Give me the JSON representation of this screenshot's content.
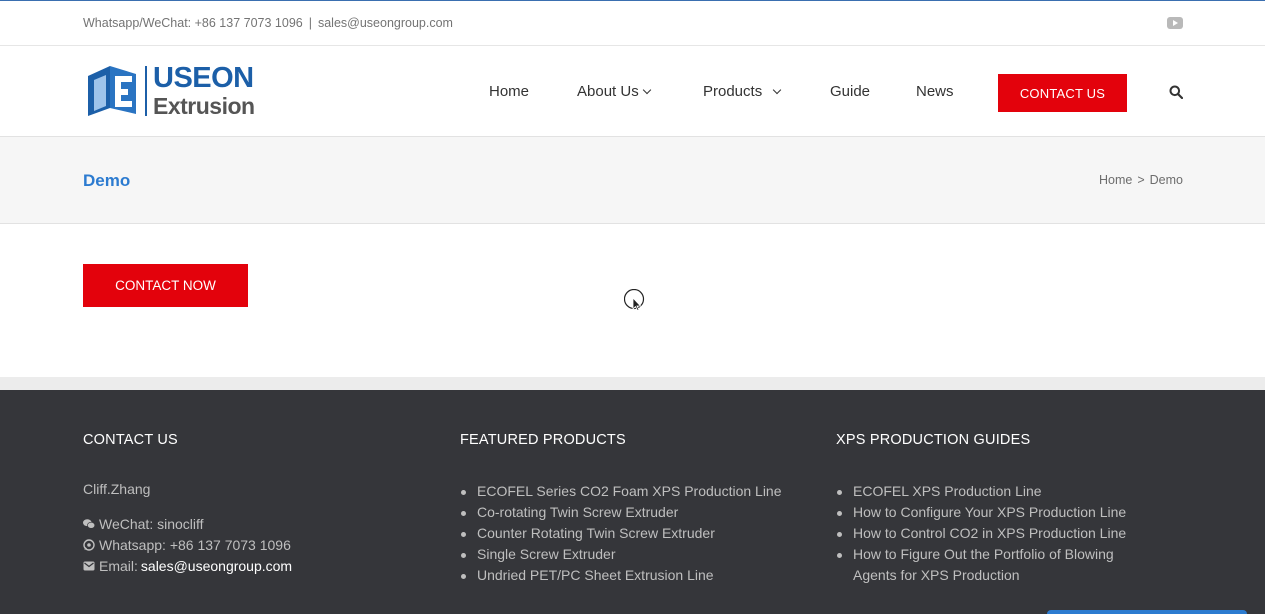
{
  "topbar": {
    "whatsapp": "Whatsapp/WeChat: +86 137 7073 1096",
    "separator": "|",
    "email": "sales@useongroup.com",
    "social_icon": "youtube-icon"
  },
  "brand": {
    "name_line1": "USEON",
    "name_line2": "Extrusion",
    "primary_color": "#1c5fa8",
    "accent_color": "#e3020c"
  },
  "nav": {
    "items": [
      {
        "label": "Home",
        "dropdown": false
      },
      {
        "label": "About Us",
        "dropdown": true
      },
      {
        "label": "Products",
        "dropdown": true
      },
      {
        "label": "Guide",
        "dropdown": false
      },
      {
        "label": "News",
        "dropdown": false
      }
    ],
    "cta_label": "CONTACT US",
    "search_icon": "search-icon"
  },
  "page": {
    "title": "Demo",
    "breadcrumb": [
      "Home",
      "Demo"
    ],
    "breadcrumb_sep": ">",
    "contact_button": "CONTACT NOW"
  },
  "footer": {
    "contact": {
      "heading": "CONTACT US",
      "name": "Cliff.Zhang",
      "wechat": "WeChat: sinocliff",
      "whatsapp": "Whatsapp: +86 137 7073 1096",
      "email_label": "Email:",
      "email": "sales@useongroup.com"
    },
    "products": {
      "heading": "FEATURED PRODUCTS",
      "items": [
        "ECOFEL Series CO2 Foam XPS Production Line",
        "Co-rotating Twin Screw Extruder",
        "Counter Rotating Twin Screw Extruder",
        "Single Screw Extruder",
        "Undried PET/PC Sheet Extrusion Line"
      ]
    },
    "guides": {
      "heading": "XPS PRODUCTION GUIDES",
      "items": [
        "ECOFEL XPS Production Line",
        "How to Configure Your XPS Production Line",
        "How to Control CO2 in XPS Production Line",
        "How to Figure Out the Portfolio of Blowing Agents for XPS Production"
      ]
    }
  }
}
